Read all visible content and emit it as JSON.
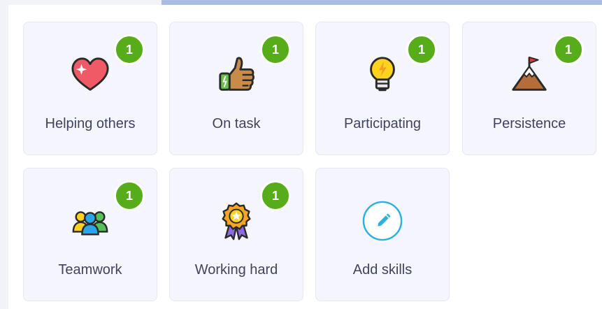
{
  "skills": [
    {
      "label": "Helping others",
      "count": "1",
      "icon": "heart-icon"
    },
    {
      "label": "On task",
      "count": "1",
      "icon": "thumbs-up-icon"
    },
    {
      "label": "Participating",
      "count": "1",
      "icon": "lightbulb-icon"
    },
    {
      "label": "Persistence",
      "count": "1",
      "icon": "mountain-flag-icon"
    },
    {
      "label": "Teamwork",
      "count": "1",
      "icon": "group-icon"
    },
    {
      "label": "Working hard",
      "count": "1",
      "icon": "medal-icon"
    }
  ],
  "add_skills": {
    "label": "Add skills",
    "icon": "pencil-icon"
  },
  "colors": {
    "badge": "#57ad19",
    "card_bg": "#f5f6fd",
    "label_text": "#3f435f",
    "accent": "#2bb0e0"
  }
}
